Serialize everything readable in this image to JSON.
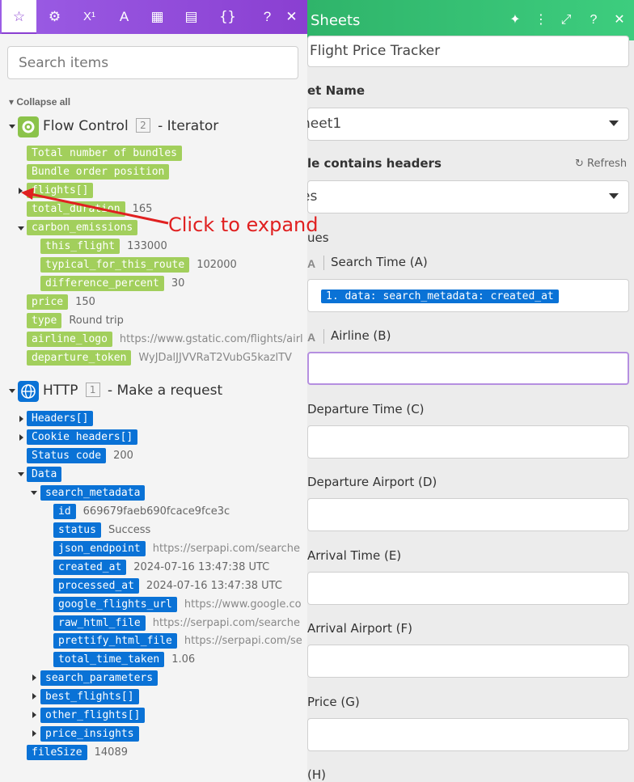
{
  "left_panel": {
    "tabs": [
      {
        "icon": "star-icon",
        "glyph": "☆"
      },
      {
        "icon": "gear-icon",
        "glyph": "⚙"
      },
      {
        "icon": "superscript-icon",
        "glyph": "X¹"
      },
      {
        "icon": "text-icon",
        "glyph": "A"
      },
      {
        "icon": "calendar-icon",
        "glyph": "▦"
      },
      {
        "icon": "table-icon",
        "glyph": "▤"
      },
      {
        "icon": "braces-icon",
        "glyph": "{}"
      },
      {
        "icon": "help-icon",
        "glyph": "?"
      },
      {
        "icon": "close-icon",
        "glyph": "✕"
      }
    ],
    "search_placeholder": "Search items",
    "collapse_all": "Collapse all",
    "flow_control": {
      "name": "Flow Control",
      "number": "2",
      "suffix": "- Iterator",
      "items": {
        "total_bundles": "Total number of bundles",
        "bundle_position": "Bundle order position",
        "flights": "flights[]",
        "total_duration": "total_duration",
        "total_duration_val": "165",
        "carbon_emissions": "carbon_emissions",
        "this_flight": "this_flight",
        "this_flight_val": "133000",
        "typical": "typical_for_this_route",
        "typical_val": "102000",
        "difference": "difference_percent",
        "difference_val": "30",
        "price": "price",
        "price_val": "150",
        "type": "type",
        "type_val": "Round trip",
        "airline_logo": "airline_logo",
        "airline_logo_val": "https://www.gstatic.com/flights/airl",
        "departure_token": "departure_token",
        "departure_token_val": "WyJDalJJVVRaT2VubG5kazlTV"
      }
    },
    "http": {
      "name": "HTTP",
      "number": "1",
      "suffix": "- Make a request",
      "items": {
        "headers": "Headers[]",
        "cookie": "Cookie headers[]",
        "status_code": "Status code",
        "status_code_val": "200",
        "data": "Data",
        "search_metadata": "search_metadata",
        "id": "id",
        "id_val": "669679faeb690fcace9fce3c",
        "status": "status",
        "status_val": "Success",
        "json_endpoint": "json_endpoint",
        "json_endpoint_val": "https://serpapi.com/searche",
        "created_at": "created_at",
        "created_at_val": "2024-07-16 13:47:38 UTC",
        "processed_at": "processed_at",
        "processed_at_val": "2024-07-16 13:47:38 UTC",
        "google_flights_url": "google_flights_url",
        "google_flights_url_val": "https://www.google.co",
        "raw_html_file": "raw_html_file",
        "raw_html_file_val": "https://serpapi.com/searche",
        "prettify_html_file": "prettify_html_file",
        "prettify_html_file_val": "https://serpapi.com/se",
        "total_time_taken": "total_time_taken",
        "total_time_taken_val": "1.06",
        "search_parameters": "search_parameters",
        "best_flights": "best_flights[]",
        "other_flights": "other_flights[]",
        "price_insights": "price_insights",
        "file_size": "fileSize",
        "file_size_val": "14089"
      }
    },
    "annotation": "Click to expand"
  },
  "right_panel": {
    "title": "Sheets",
    "header_icons": [
      "sparkle-icon",
      "more-icon",
      "expand-icon",
      "help-icon",
      "close-icon"
    ],
    "spreadsheet_value": "Flight Price Tracker",
    "sheet_name_label": "et Name",
    "sheet_name_value": "heet1",
    "headers_label": "le contains headers",
    "refresh_label": "Refresh",
    "headers_value": "es",
    "values_label": "ues",
    "columns": {
      "search_time": "Search Time (A)",
      "search_time_value": "1. data: search_metadata: created_at",
      "airline": "Airline (B)",
      "departure_time": "Departure Time (C)",
      "departure_airport": "Departure Airport (D)",
      "arrival_time": "Arrival Time (E)",
      "arrival_airport": "Arrival Airport (F)",
      "price": "Price (G)",
      "h": "(H)"
    }
  },
  "colors": {
    "purple": "#8a3fd1",
    "green_header": "#2fb46a",
    "green_pill": "#a2cf5c",
    "blue_pill": "#0a72d6",
    "annotation_red": "#e02020"
  }
}
